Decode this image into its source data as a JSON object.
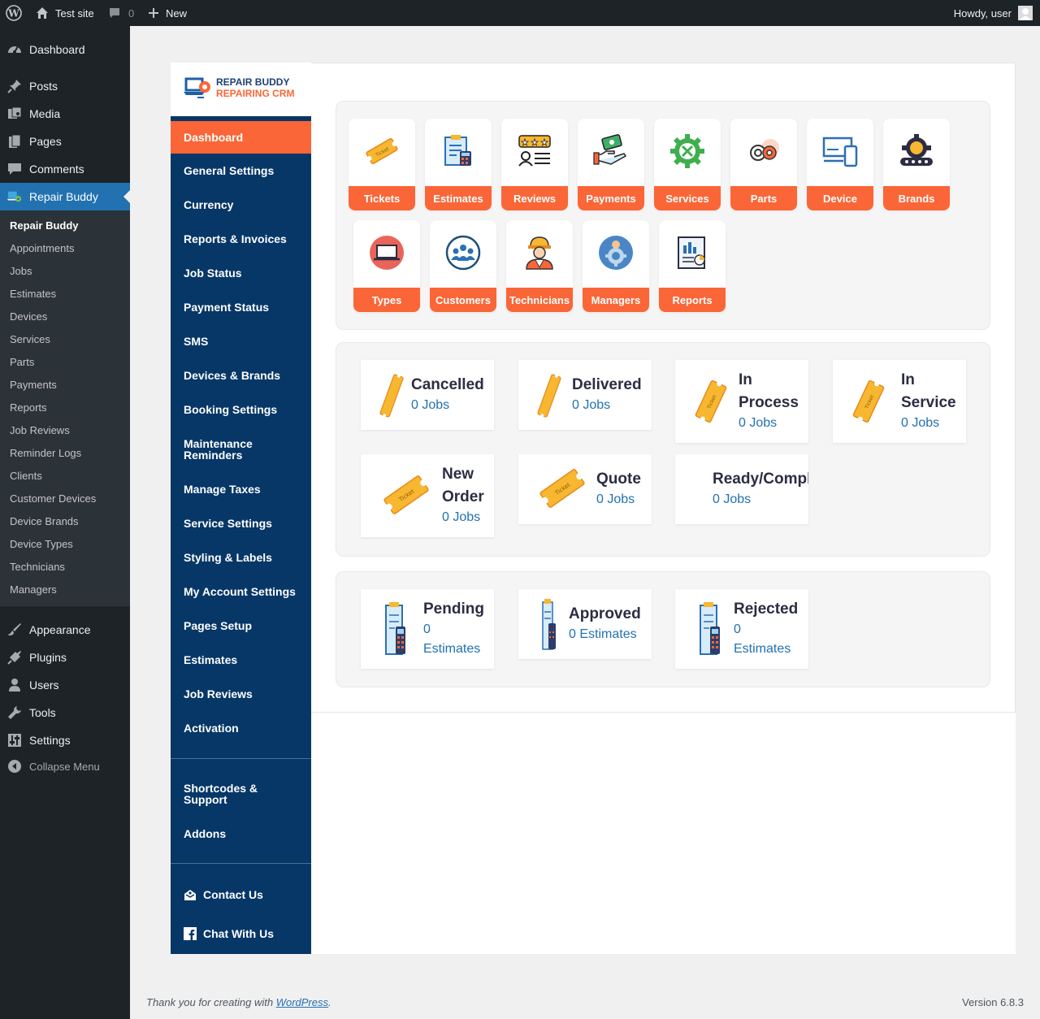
{
  "admin_bar": {
    "site_name": "Test site",
    "comments_count": "0",
    "new_label": "New",
    "howdy": "Howdy, user"
  },
  "admin_menu": {
    "items": [
      {
        "label": "Dashboard",
        "icon": "dashboard-icon"
      },
      {
        "label": "Posts",
        "icon": "pin-icon"
      },
      {
        "label": "Media",
        "icon": "media-icon"
      },
      {
        "label": "Pages",
        "icon": "pages-icon"
      },
      {
        "label": "Comments",
        "icon": "comment-icon"
      },
      {
        "label": "Repair Buddy",
        "icon": "repair-buddy-icon"
      },
      {
        "label": "Appearance",
        "icon": "brush-icon"
      },
      {
        "label": "Plugins",
        "icon": "plug-icon"
      },
      {
        "label": "Users",
        "icon": "user-icon"
      },
      {
        "label": "Tools",
        "icon": "wrench-icon"
      },
      {
        "label": "Settings",
        "icon": "settings-icon"
      },
      {
        "label": "Collapse Menu",
        "icon": "collapse-icon"
      }
    ],
    "submenu": [
      "Repair Buddy",
      "Appointments",
      "Jobs",
      "Estimates",
      "Devices",
      "Services",
      "Parts",
      "Payments",
      "Reports",
      "Job Reviews",
      "Reminder Logs",
      "Clients",
      "Customer Devices",
      "Device Brands",
      "Device Types",
      "Technicians",
      "Managers"
    ]
  },
  "logo": {
    "line1": "REPAIR BUDDY",
    "line2": "REPAIRING CRM"
  },
  "rb_nav": {
    "items": [
      "Dashboard",
      "General Settings",
      "Currency",
      "Reports & Invoices",
      "Job Status",
      "Payment Status",
      "SMS",
      "Devices & Brands",
      "Booking Settings",
      "Maintenance Reminders",
      "Manage Taxes",
      "Service Settings",
      "Styling & Labels",
      "My Account Settings",
      "Pages Setup",
      "Estimates",
      "Job Reviews",
      "Activation"
    ],
    "support": [
      "Shortcodes & Support",
      "Addons"
    ],
    "contact": "Contact Us",
    "chat": "Chat With Us"
  },
  "tiles": [
    "Tickets",
    "Estimates",
    "Reviews",
    "Payments",
    "Services",
    "Parts",
    "Device",
    "Brands",
    "Types",
    "Customers",
    "Technicians",
    "Managers",
    "Reports"
  ],
  "job_cards": [
    {
      "title": "Cancelled",
      "value": "0 Jobs"
    },
    {
      "title": "Delivered",
      "value": "0 Jobs"
    },
    {
      "title": "In Process",
      "value": "0 Jobs"
    },
    {
      "title": "In Service",
      "value": "0 Jobs"
    },
    {
      "title": "New Order",
      "value": "0 Jobs"
    },
    {
      "title": "Quote",
      "value": "0 Jobs"
    },
    {
      "title": "Ready/Complete",
      "value": "0 Jobs"
    }
  ],
  "estimate_cards": [
    {
      "title": "Pending",
      "value": "0 Estimates"
    },
    {
      "title": "Approved",
      "value": "0 Estimates"
    },
    {
      "title": "Rejected",
      "value": "0 Estimates"
    }
  ],
  "footer": {
    "thanks_prefix": "Thank you for creating with ",
    "link": "WordPress",
    "suffix": ".",
    "version": "Version 6.8.3"
  },
  "colors": {
    "accent": "#fa6637",
    "nav_bg": "#063767",
    "wp_blue": "#2271b1",
    "admin_dark": "#1d2327"
  }
}
